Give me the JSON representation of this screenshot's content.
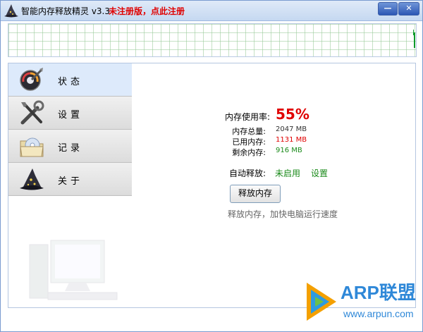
{
  "window": {
    "title": "智能内存释放精灵 v3.3",
    "register_link": "未注册版，点此注册",
    "minimize": "—",
    "close": "✕"
  },
  "sidebar": {
    "items": [
      {
        "label": "状态",
        "icon": "speedometer-icon",
        "active": true
      },
      {
        "label": "设置",
        "icon": "tools-icon",
        "active": false
      },
      {
        "label": "记录",
        "icon": "folder-cd-icon",
        "active": false
      },
      {
        "label": "关于",
        "icon": "wizard-hat-icon",
        "active": false
      }
    ]
  },
  "status": {
    "usage_label": "内存使用率:",
    "usage_value": "55%",
    "total_label": "内存总量:",
    "total_value": "2047 MB",
    "used_label": "已用内存:",
    "used_value": "1131 MB",
    "free_label": "剩余内存:",
    "free_value": "916 MB",
    "auto_label": "自动释放:",
    "auto_value": "未启用",
    "settings_link": "设置",
    "release_button": "释放内存",
    "hint": "释放内存，加快电脑运行速度"
  },
  "watermark": {
    "brand": "ARP联盟",
    "url": "www.arpun.com"
  },
  "colors": {
    "usage": "#e00000",
    "used": "#e00000",
    "free": "#1a8a1a",
    "accent": "#2c57b4"
  }
}
